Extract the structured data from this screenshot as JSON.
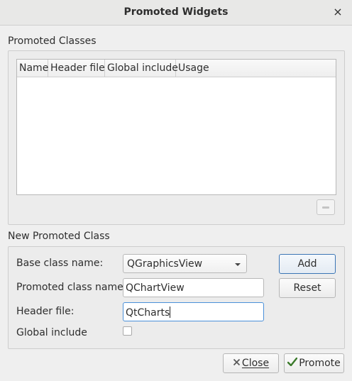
{
  "window": {
    "title": "Promoted Widgets",
    "close_glyph": "×"
  },
  "promoted_classes": {
    "label": "Promoted Classes",
    "columns": [
      "Name",
      "Header file",
      "Global include",
      "Usage"
    ],
    "rows": []
  },
  "new_class": {
    "label": "New Promoted Class",
    "base_class_label": "Base class name:",
    "base_class_value": "QGraphicsView",
    "promoted_class_label": "Promoted class name:",
    "promoted_class_value": "QChartView",
    "header_file_label": "Header file:",
    "header_file_value": "QtCharts",
    "global_include_label": "Global include",
    "global_include_checked": false,
    "add_label": "Add",
    "reset_label": "Reset"
  },
  "footer": {
    "close_label": "Close",
    "promote_label": "Promote"
  },
  "colors": {
    "focus": "#4a90d9",
    "default_button": "#3b75b5"
  }
}
